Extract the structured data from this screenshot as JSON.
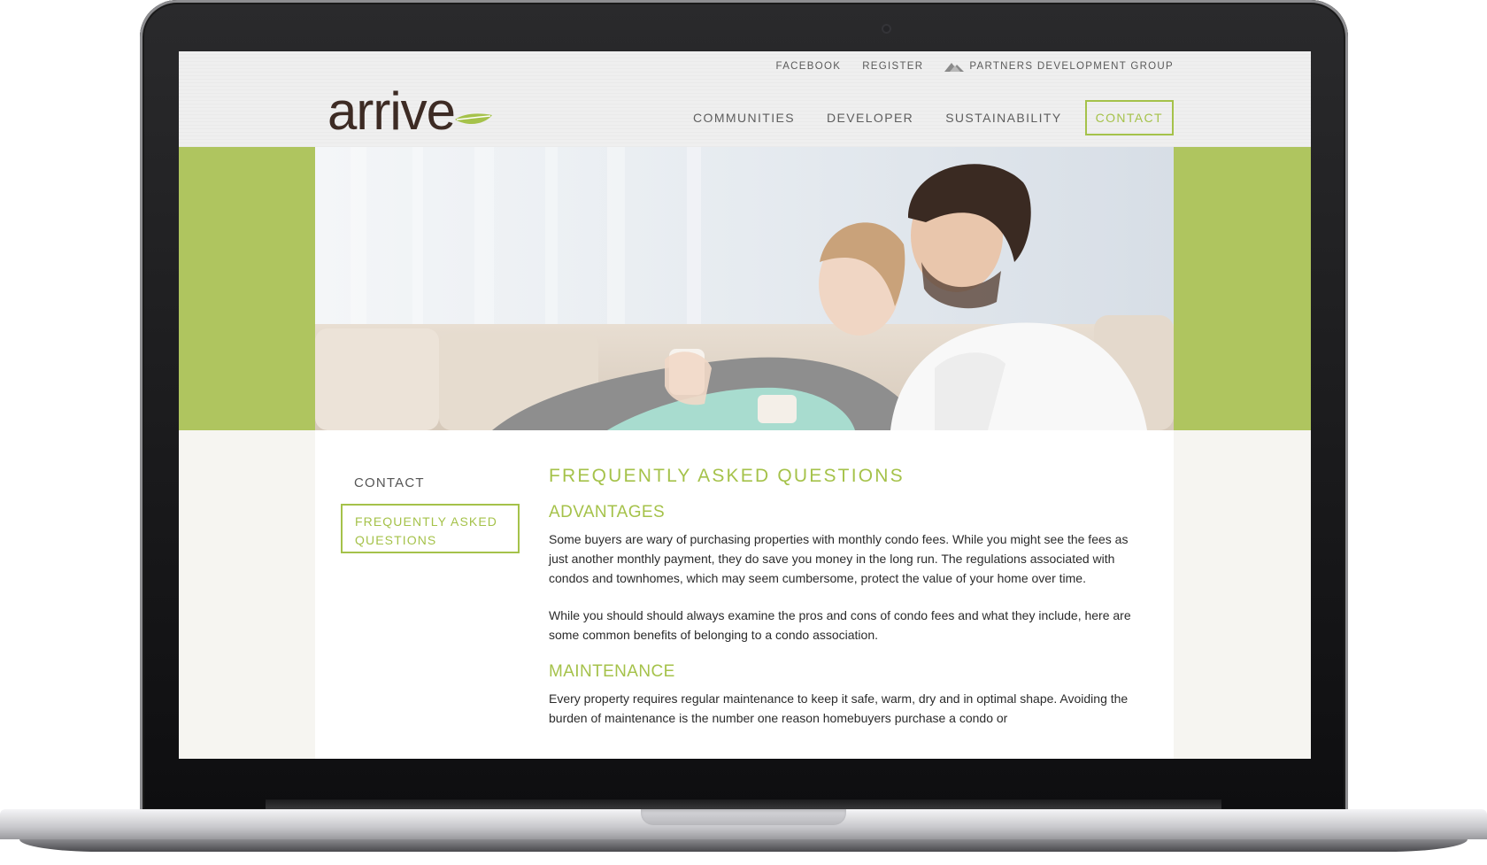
{
  "utility_nav": {
    "facebook": "FACEBOOK",
    "register": "REGISTER",
    "partners": "PARTNERS DEVELOPMENT GROUP"
  },
  "logo": {
    "text": "arrive"
  },
  "main_nav": {
    "items": [
      "COMMUNITIES",
      "DEVELOPER",
      "SUSTAINABILITY"
    ],
    "active": "CONTACT"
  },
  "sidebar": {
    "contact": "CONTACT",
    "faq": "FREQUENTLY ASKED QUESTIONS"
  },
  "article": {
    "title": "FREQUENTLY ASKED QUESTIONS",
    "sections": [
      {
        "heading": "ADVANTAGES",
        "paragraphs": [
          "Some buyers are wary of purchasing properties with monthly condo fees. While you might see the fees as just another monthly payment, they do save you money in the long run. The regulations associated with condos and townhomes, which may seem cumbersome, protect the value of your home over time.",
          "While you should should always examine the pros and cons of condo fees and what they include, here are some common benefits of belonging to a condo association."
        ]
      },
      {
        "heading": "MAINTENANCE",
        "paragraphs": [
          "Every property requires regular maintenance to keep it safe, warm, dry and in optimal shape. Avoiding the burden of maintenance is the number one reason homebuyers purchase a condo or"
        ]
      }
    ]
  },
  "colors": {
    "accent_green": "#a5c24a",
    "hero_band_green": "#afc55f",
    "logo_brown": "#3d2b24",
    "header_bg": "#efefef"
  },
  "icons": [
    "partners-logo-icon",
    "leaf-icon"
  ]
}
